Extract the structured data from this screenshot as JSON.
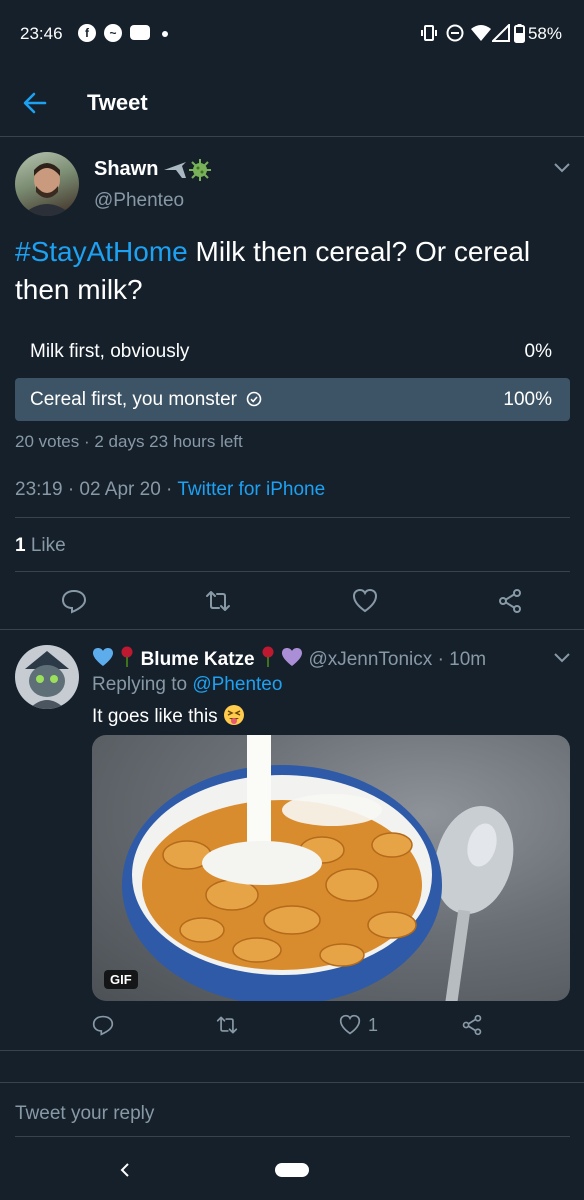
{
  "status_bar": {
    "time": "23:46",
    "battery": "58%"
  },
  "header": {
    "title": "Tweet"
  },
  "tweet": {
    "author_name": "Shawn",
    "author_handle": "@Phenteo",
    "hashtag": "#StayAtHome",
    "text": "Milk then cereal? Or cereal then milk?",
    "poll": {
      "options": [
        {
          "label": "Milk first, obviously",
          "percent": "0%"
        },
        {
          "label": "Cereal first, you monster",
          "percent": "100%"
        }
      ],
      "summary": "20 votes · 2 days 23 hours left"
    },
    "timestamp": "23:19 · 02 Apr 20 · ",
    "source": "Twitter for iPhone",
    "likes_count": "1",
    "likes_label": "Like"
  },
  "reply": {
    "author_name": "Blume Katze",
    "author_handle": "@xJennTonicx",
    "age": "· 10m",
    "replying_to_prefix": "Replying to ",
    "replying_to_handle": "@Phenteo",
    "text": "It goes like this",
    "emoji": "😝",
    "gif_badge": "GIF",
    "like_count": "1"
  },
  "composer": {
    "placeholder": "Tweet your reply"
  },
  "colors": {
    "background": "#15202b",
    "accent": "#1da1f2",
    "muted": "#8899a6",
    "divider": "#38444d",
    "poll_winner": "#3d5466"
  }
}
